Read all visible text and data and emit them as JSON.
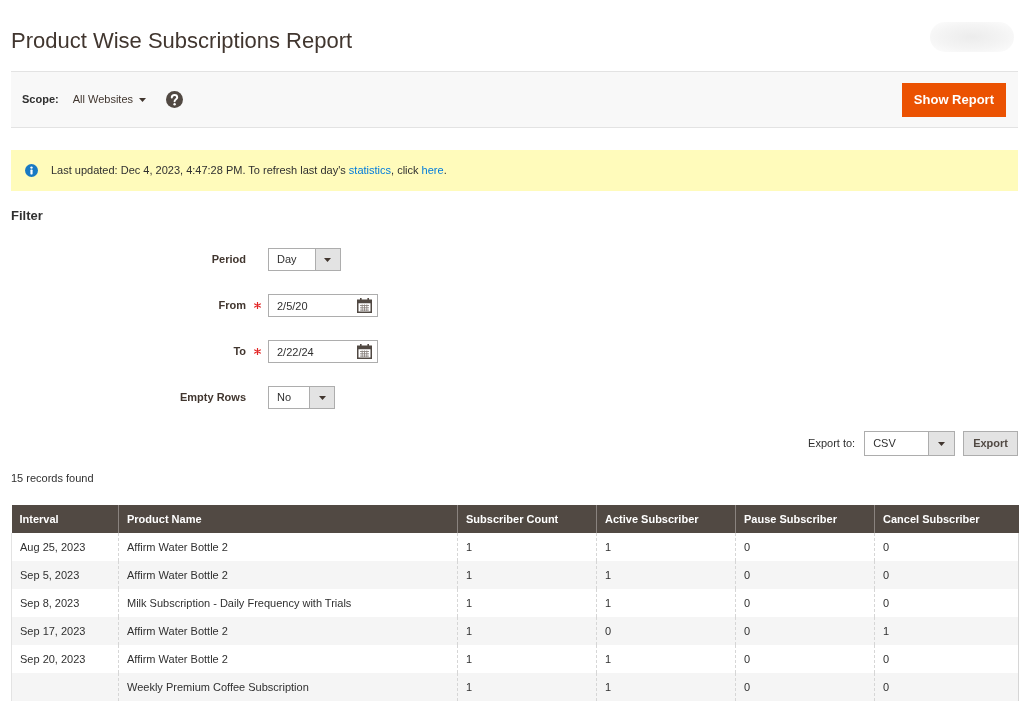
{
  "page_title": "Product Wise Subscriptions Report",
  "scope": {
    "label": "Scope:",
    "value": "All Websites"
  },
  "show_report_button": "Show Report",
  "message": {
    "parts": [
      {
        "kind": "text",
        "text": "Last updated: Dec 4, 2023, 4:47:28 PM. To refresh last day's "
      },
      {
        "kind": "link",
        "text": "statistics"
      },
      {
        "kind": "text",
        "text": ", click "
      },
      {
        "kind": "link",
        "text": "here"
      },
      {
        "kind": "text",
        "text": "."
      }
    ]
  },
  "filter": {
    "heading": "Filter",
    "fields": [
      {
        "kind": "select",
        "label": "Period",
        "value": "Day",
        "required": false
      },
      {
        "kind": "date",
        "label": "From",
        "value": "2/5/20",
        "required": true
      },
      {
        "kind": "date",
        "label": "To",
        "value": "2/22/24",
        "required": true
      },
      {
        "kind": "select",
        "label": "Empty Rows",
        "value": "No",
        "required": false
      }
    ]
  },
  "export": {
    "label": "Export to:",
    "value": "CSV",
    "button": "Export"
  },
  "records_found": "15 records found",
  "table": {
    "columns": [
      "Interval",
      "Product Name",
      "Subscriber Count",
      "Active Subscriber",
      "Pause Subscriber",
      "Cancel Subscriber"
    ],
    "rows": [
      {
        "interval": "Aug 25, 2023",
        "product_name": "Affirm Water Bottle 2",
        "subscriber_count": "1",
        "active_subscriber": "1",
        "pause_subscriber": "0",
        "cancel_subscriber": "0"
      },
      {
        "interval": "Sep 5, 2023",
        "product_name": "Affirm Water Bottle 2",
        "subscriber_count": "1",
        "active_subscriber": "1",
        "pause_subscriber": "0",
        "cancel_subscriber": "0"
      },
      {
        "interval": "Sep 8, 2023",
        "product_name": "Milk Subscription - Daily Frequency with Trials",
        "subscriber_count": "1",
        "active_subscriber": "1",
        "pause_subscriber": "0",
        "cancel_subscriber": "0"
      },
      {
        "interval": "Sep 17, 2023",
        "product_name": "Affirm Water Bottle 2",
        "subscriber_count": "1",
        "active_subscriber": "0",
        "pause_subscriber": "0",
        "cancel_subscriber": "1"
      },
      {
        "interval": "Sep 20, 2023",
        "product_name": "Affirm Water Bottle 2",
        "subscriber_count": "1",
        "active_subscriber": "1",
        "pause_subscriber": "0",
        "cancel_subscriber": "0"
      },
      {
        "product_name": "Weekly Premium Coffee Subscription",
        "subscriber_count": "1",
        "active_subscriber": "1",
        "pause_subscriber": "0",
        "cancel_subscriber": "0"
      }
    ]
  }
}
